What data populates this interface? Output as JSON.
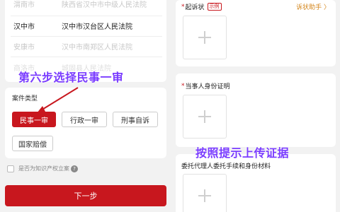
{
  "courts": [
    {
      "city": "渭南市",
      "name": "陕西省汉中市中级人民法院",
      "state": "dim"
    },
    {
      "city": "汉中市",
      "name": "汉中市汉台区人民法院",
      "state": "active"
    },
    {
      "city": "安康市",
      "name": "汉中市南郑区人民法院",
      "state": "dim"
    },
    {
      "city": "商洛市",
      "name": "城固县人民法院",
      "state": "dim"
    }
  ],
  "annotations": {
    "step6": "第六步选择民事一审",
    "upload_hint": "按照提示上传证据"
  },
  "case_type": {
    "label": "案件类型",
    "options": [
      "民事一审",
      "行政一审",
      "刑事自诉",
      "国家赔偿"
    ],
    "selected": "民事一审"
  },
  "ip_check": {
    "label": "是否为知识产权立案",
    "help_icon": "question-icon"
  },
  "next_button": "下一步",
  "uploads": {
    "complaint": {
      "title": "起诉状",
      "badge": "示例",
      "helper": "诉状助手 〉"
    },
    "party_id": {
      "title": "当事人身份证明"
    },
    "agent": {
      "title": "委托代理人委托手续和身份材料"
    }
  },
  "colors": {
    "brand_red": "#c8171e",
    "annotation_purple": "#7a3cff",
    "helper_orange": "#d4861c"
  }
}
